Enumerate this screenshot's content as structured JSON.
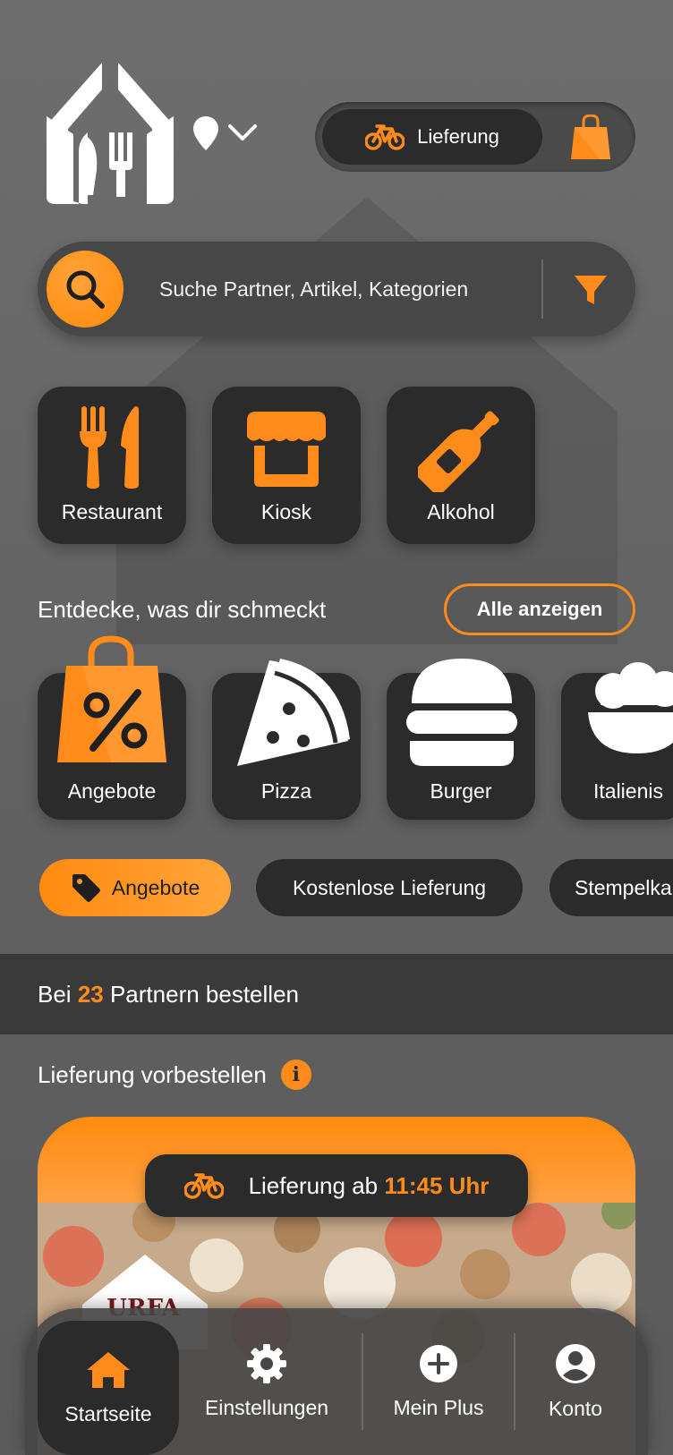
{
  "header": {
    "mode_active_label": "Lieferung"
  },
  "search": {
    "placeholder": "Suche Partner, Artikel, Kategorien"
  },
  "categories": [
    {
      "label": "Restaurant"
    },
    {
      "label": "Kiosk"
    },
    {
      "label": "Alkohol"
    }
  ],
  "discover": {
    "title": "Entdecke, was dir schmeckt",
    "all_button": "Alle anzeigen",
    "items": [
      {
        "label": "Angebote"
      },
      {
        "label": "Pizza"
      },
      {
        "label": "Burger"
      },
      {
        "label": "Italienis"
      }
    ]
  },
  "chips": [
    {
      "label": "Angebote",
      "active": true
    },
    {
      "label": "Kostenlose Lieferung",
      "active": false
    },
    {
      "label": "Stempelka",
      "active": false
    }
  ],
  "partners": {
    "prefix": "Bei",
    "count": "23",
    "suffix": "Partnern bestellen"
  },
  "preorder": {
    "title": "Lieferung vorbestellen",
    "info_icon": "i"
  },
  "promo": {
    "prefix": "Lieferung ab",
    "time": "11:45 Uhr",
    "brand": "URFA"
  },
  "nav": {
    "items": [
      {
        "label": "Startseite",
        "icon": "home-icon",
        "active": true
      },
      {
        "label": "Einstellungen",
        "icon": "gear-icon",
        "active": false
      },
      {
        "label": "Mein Plus",
        "icon": "plus-circle-icon",
        "active": false
      },
      {
        "label": "Konto",
        "icon": "account-icon",
        "active": false
      }
    ]
  },
  "colors": {
    "accent": "#ff8c1a",
    "tile": "#2b2b2b",
    "background": "#666666"
  }
}
